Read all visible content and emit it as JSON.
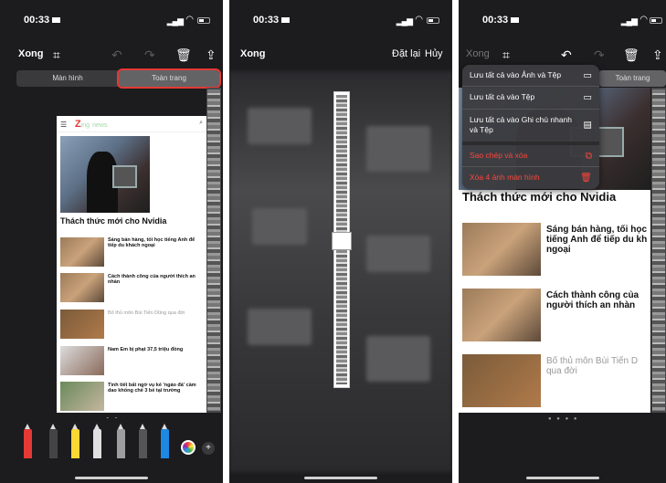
{
  "status": {
    "time": "00:33"
  },
  "panel1": {
    "toolbar": {
      "done": "Xong"
    },
    "tabs": [
      "Màn hình",
      "Toàn trang"
    ],
    "site": {
      "logo_z": "Z",
      "logo_rest": "ing",
      "logo_sub": "news"
    },
    "headline": "Thách thức mới cho Nvidia",
    "articles": [
      {
        "title": "Sáng bán hàng, tối học tiếng Anh để tiếp du khách ngoại",
        "gray": false
      },
      {
        "title": "Cách thành công của người thích an nhàn",
        "gray": false
      },
      {
        "title": "Bố thủ môn Bùi Tiến Dũng qua đời",
        "gray": true
      },
      {
        "title": "Nam Em bị phạt 37,5 triệu đồng",
        "gray": false
      },
      {
        "title": "Tình tiết bất ngờ vụ kẻ 'ngáo đá' cầm dao khống chế 3 bé tại trường",
        "gray": false
      }
    ],
    "pens": [
      "#e53935",
      "#444444",
      "#fdd835",
      "#e0e0e0",
      "#9e9e9e",
      "#555555",
      "#1e88e5"
    ]
  },
  "panel2": {
    "toolbar": {
      "done": "Xong",
      "reset": "Đặt lại",
      "cancel": "Hủy"
    }
  },
  "panel3": {
    "toolbar": {
      "done": "Xong"
    },
    "tabs": [
      "Toàn trang"
    ],
    "menu": [
      {
        "label": "Lưu tất cả vào Ảnh và Tệp",
        "icon": "folder-icon",
        "red": false
      },
      {
        "label": "Lưu tất cả vào Tệp",
        "icon": "folder-icon",
        "red": false
      },
      {
        "label": "Lưu tất cả vào Ghi chú nhanh và Tệp",
        "icon": "note-icon",
        "red": false
      },
      {
        "label": "Sao chép và xóa",
        "icon": "copy-delete-icon",
        "red": true
      },
      {
        "label": "Xóa 4 ảnh màn hình",
        "icon": "trash-icon",
        "red": true
      }
    ],
    "headline": "Thách thức mới cho Nvidia",
    "articles": [
      {
        "title": "Sáng bán hàng, tối học tiếng Anh để tiếp du kh ngoại",
        "gray": false
      },
      {
        "title": "Cách thành công của người thích an nhàn",
        "gray": false
      },
      {
        "title": "Bố thủ môn Bùi Tiến D qua đời",
        "gray": true
      }
    ]
  },
  "colors": {
    "accent_red": "#e53935",
    "background": "#1c1c1e",
    "menu_bg": "#3c3c40"
  }
}
